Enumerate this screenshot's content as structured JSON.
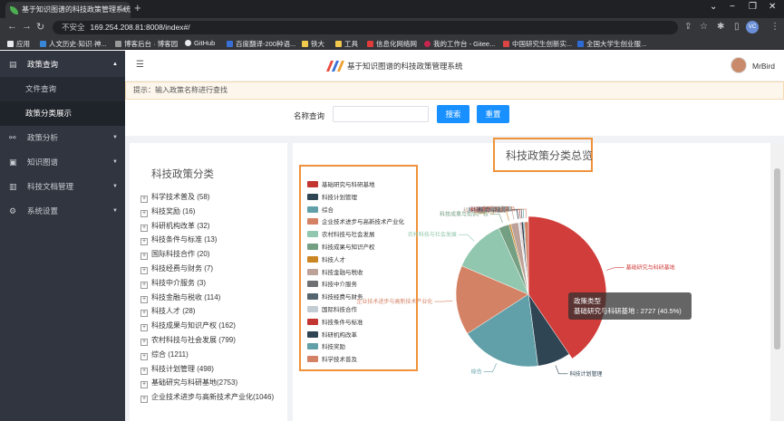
{
  "browser": {
    "tab_title": "基于知识图谱的科技政策管理系统",
    "url_insecure": "不安全",
    "url": "169.254.208.81:8008/index#/",
    "bookmarks": [
      "应用",
      "人文历史·知识·神...",
      "博客后台 · 博客园",
      "GitHub",
      "百度翻译-200种语...",
      "铁大",
      "工具",
      "信息化网络网",
      "我的工作台 - Gitee...",
      "中国研究生创新实...",
      "全国大学生创业服..."
    ]
  },
  "sidebar": {
    "items": [
      {
        "label": "政策查询",
        "icon": "document-icon",
        "expanded": true
      },
      {
        "label": "文件查询",
        "sub": true
      },
      {
        "label": "政策分类展示",
        "sub": true,
        "active": true
      },
      {
        "label": "政策分析",
        "icon": "analysis-icon"
      },
      {
        "label": "知识图谱",
        "icon": "graph-icon"
      },
      {
        "label": "科技文档管理",
        "icon": "folder-icon"
      },
      {
        "label": "系统设置",
        "icon": "settings-icon"
      }
    ]
  },
  "header": {
    "title": "基于知识图谱的科技政策管理系统",
    "username": "MrBird"
  },
  "hint": "提示：输入政策名称进行查找",
  "search": {
    "label": "名称查询",
    "value": "",
    "placeholder": "",
    "search_btn": "搜索",
    "reset_btn": "重置"
  },
  "tree": {
    "title": "科技政策分类",
    "items": [
      "科学技术普及 (58)",
      "科技奖励 (16)",
      "科研机构改革 (32)",
      "科技条件与标准 (13)",
      "国际科技合作 (20)",
      "科技经费与财务 (7)",
      "科技中介服务 (3)",
      "科技金融与税收 (114)",
      "科技人才 (28)",
      "科技成果与知识产权 (162)",
      "农村科技与社会发展 (799)",
      "综合 (1211)",
      "科技计划管理 (498)",
      "基础研究与科研基地(2753)",
      "企业技术进步与高新技术产业化(1046)"
    ]
  },
  "chart_data": {
    "type": "pie",
    "title": "科技政策分类总览",
    "series_name": "政策类型",
    "legend": [
      {
        "name": "基础研究与科研基地",
        "color": "#c23531"
      },
      {
        "name": "科技计划管理",
        "color": "#2f4554"
      },
      {
        "name": "综合",
        "color": "#61a0a8"
      },
      {
        "name": "企业技术进步与高新技术产业化",
        "color": "#d48265"
      },
      {
        "name": "农村科技与社会发展",
        "color": "#91c7ae"
      },
      {
        "name": "科技成果与知识产权",
        "color": "#749f83"
      },
      {
        "name": "科技人才",
        "color": "#ca8622"
      },
      {
        "name": "科技金融与税收",
        "color": "#bda29a"
      },
      {
        "name": "科技中介服务",
        "color": "#6e7074"
      },
      {
        "name": "科技经费与财务",
        "color": "#546570"
      },
      {
        "name": "国际科技合作",
        "color": "#c4ccd3"
      },
      {
        "name": "科技条件与标准",
        "color": "#c23531"
      },
      {
        "name": "科研机构改革",
        "color": "#2f4554"
      },
      {
        "name": "科技奖励",
        "color": "#61a0a8"
      },
      {
        "name": "科学技术普及",
        "color": "#d48265"
      }
    ],
    "slices": [
      {
        "name": "基础研究与科研基地",
        "value": 2727,
        "color": "#d03d3a"
      },
      {
        "name": "科技计划管理",
        "value": 498,
        "color": "#2f4554"
      },
      {
        "name": "综合",
        "value": 1211,
        "color": "#61a0a8"
      },
      {
        "name": "企业技术进步与高新技术产业化",
        "value": 1046,
        "color": "#d48265"
      },
      {
        "name": "农村科技与社会发展",
        "value": 799,
        "color": "#91c7ae"
      },
      {
        "name": "科技成果与知识产权",
        "value": 162,
        "color": "#749f83"
      },
      {
        "name": "科技人才",
        "value": 28,
        "color": "#ca8622"
      },
      {
        "name": "科技金融与税收",
        "value": 114,
        "color": "#bda29a"
      },
      {
        "name": "科技中介服务",
        "value": 3,
        "color": "#6e7074"
      },
      {
        "name": "科技经费与财务",
        "value": 7,
        "color": "#546570"
      },
      {
        "name": "国际科技合作",
        "value": 20,
        "color": "#c4ccd3"
      },
      {
        "name": "科技条件与标准",
        "value": 13,
        "color": "#c23531"
      },
      {
        "name": "科研机构改革",
        "value": 32,
        "color": "#2f4554"
      },
      {
        "name": "科技奖励",
        "value": 16,
        "color": "#61a0a8"
      },
      {
        "name": "科学技术普及",
        "value": 58,
        "color": "#d48265"
      }
    ],
    "tooltip": {
      "title": "政策类型",
      "text": "基础研究与科研基地 : 2727 (40.5%)"
    }
  }
}
